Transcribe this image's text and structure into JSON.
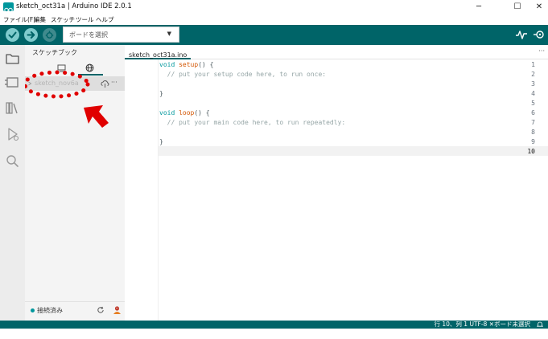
{
  "window": {
    "title": "sketch_oct31a | Arduino IDE 2.0.1",
    "minimize": "─",
    "maximize": "☐",
    "close": "✕"
  },
  "menu": [
    {
      "label": "ファイル(F)"
    },
    {
      "label": "編集"
    },
    {
      "label": "スケッチ"
    },
    {
      "label": "ツール"
    },
    {
      "label": "ヘルプ"
    }
  ],
  "toolbar": {
    "board_placeholder": "ボードを選択",
    "caret": "▼"
  },
  "sidebar": {
    "title": "スケッチブック",
    "sketch_name": "sketch_nov6a",
    "more": "···",
    "status": "接続済み"
  },
  "editor": {
    "tab_label": "sketch_oct31a.ino",
    "more": "···",
    "lines": [
      {
        "n": "1",
        "kw": "void ",
        "fn": "setup",
        "rest": "() {",
        "cm": ""
      },
      {
        "n": "2",
        "kw": "",
        "fn": "",
        "rest": "  ",
        "cm": "// put your setup code here, to run once:"
      },
      {
        "n": "3",
        "kw": "",
        "fn": "",
        "rest": "",
        "cm": ""
      },
      {
        "n": "4",
        "kw": "",
        "fn": "",
        "rest": "}",
        "cm": ""
      },
      {
        "n": "5",
        "kw": "",
        "fn": "",
        "rest": "",
        "cm": ""
      },
      {
        "n": "6",
        "kw": "void ",
        "fn": "loop",
        "rest": "() {",
        "cm": ""
      },
      {
        "n": "7",
        "kw": "",
        "fn": "",
        "rest": "  ",
        "cm": "// put your main code here, to run repeatedly:"
      },
      {
        "n": "8",
        "kw": "",
        "fn": "",
        "rest": "",
        "cm": ""
      },
      {
        "n": "9",
        "kw": "",
        "fn": "",
        "rest": "}",
        "cm": ""
      },
      {
        "n": "10",
        "kw": "",
        "fn": "",
        "rest": "",
        "cm": ""
      }
    ]
  },
  "statusbar": {
    "text": "行 10、列 1   UTF-8   ✕ボード未選択"
  },
  "colors": {
    "teal": "#006468",
    "accent": "#00979d",
    "annotation_red": "#e00000"
  }
}
